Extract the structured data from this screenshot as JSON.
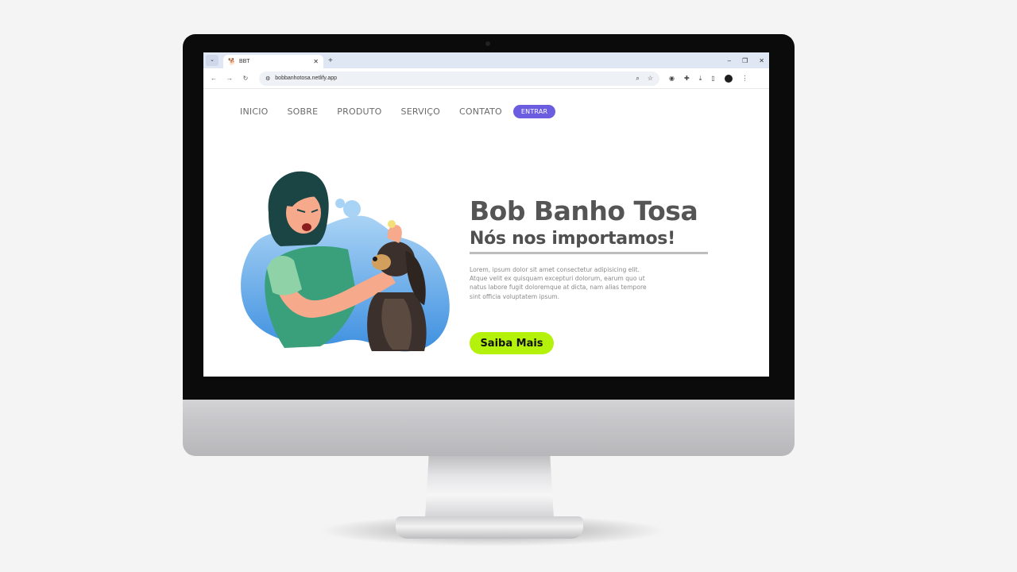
{
  "browser": {
    "tab_menu_icon": "chevron-down-icon",
    "tab": {
      "favicon_icon": "dog-icon",
      "title": "BBT",
      "close_glyph": "✕"
    },
    "new_tab_glyph": "+",
    "window_controls": {
      "minimize": "–",
      "restore": "❐",
      "close": "✕"
    },
    "nav": {
      "back": "←",
      "forward": "→",
      "reload": "↻"
    },
    "address_bar": {
      "tune_glyph": "⚙",
      "url": "bobbanhotosa.netlify.app",
      "search_glyph": "⌕",
      "bookmark_glyph": "☆"
    },
    "toolbar_icons": {
      "extensions_glyph": "✚",
      "download_glyph": "⤓",
      "sidepanel_glyph": "▯",
      "menu_glyph": "⋮"
    }
  },
  "site": {
    "nav_links": [
      "INICIO",
      "SOBRE",
      "PRODUTO",
      "SERVIÇO",
      "CONTATO"
    ],
    "login_button": "ENTRAR",
    "hero": {
      "title": "Bob Banho Tosa",
      "subtitle": "Nós nos importamos!",
      "text": "Lorem, ipsum dolor sit amet consectetur adipisicing elit. Atque velit ex quisquam excepturi dolorum, earum quo ut natus labore fugit doloremque at dicta, nam alias tempore sint officia voluptatem ipsum.",
      "cta_button": "Saiba Mais"
    },
    "colors": {
      "accent_purple": "#6b5ce0",
      "cta_green": "#b4f20c",
      "title_gray": "#555555"
    }
  }
}
